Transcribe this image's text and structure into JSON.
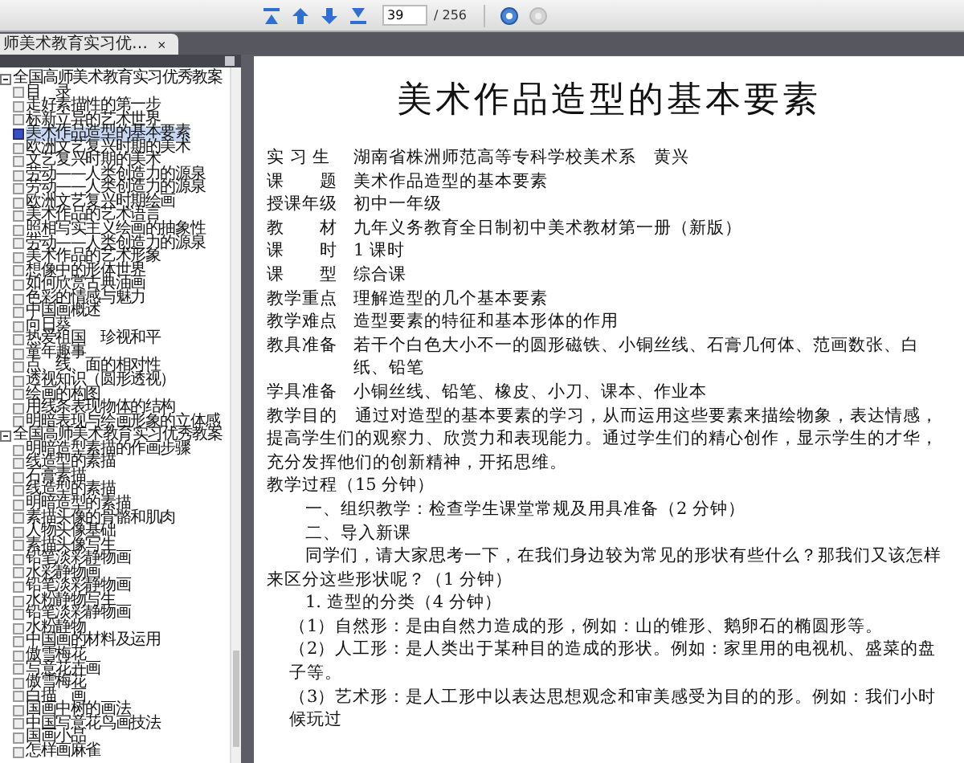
{
  "toolbar": {
    "page_input": {
      "value": "39"
    },
    "page_total": "/ 256"
  },
  "tab": {
    "label": "师美术教育实习优…",
    "close": "×",
    "selected": true
  },
  "sidebar": {
    "tree": [
      {
        "label": "全国高师美术教育实习优秀教案",
        "expanded": true,
        "selected": false,
        "children": [
          {
            "label": "目　录",
            "selected": false
          },
          {
            "label": "走好素描性的第一步",
            "selected": false
          },
          {
            "label": "标新立异的艺术世界",
            "selected": false
          },
          {
            "label": "美术作品造型的基本要素",
            "selected": true
          },
          {
            "label": "欧洲文艺复兴时期的美术",
            "selected": false
          },
          {
            "label": "文艺复兴时期的美术",
            "selected": false
          },
          {
            "label": "劳动——人类创造力的源泉",
            "selected": false
          },
          {
            "label": "劳动——人类创造力的源泉",
            "selected": false
          },
          {
            "label": "欧洲文艺复兴时期绘画",
            "selected": false
          },
          {
            "label": "美术作品的艺术语言",
            "selected": false
          },
          {
            "label": "照相写实主义绘画的抽象性",
            "selected": false
          },
          {
            "label": "劳动——人类创造力的源泉",
            "selected": false
          },
          {
            "label": "美术作品的艺术形象",
            "selected": false
          },
          {
            "label": "想像中的形体世界",
            "selected": false
          },
          {
            "label": "如何欣赏古典油画",
            "selected": false
          },
          {
            "label": "色彩的情感与魅力",
            "selected": false
          },
          {
            "label": "中国画概述",
            "selected": false
          },
          {
            "label": "向日葵",
            "selected": false
          },
          {
            "label": "热爱祖国　珍视和平",
            "selected": false
          },
          {
            "label": "童年趣事",
            "selected": false
          },
          {
            "label": "点、线、面的相对性",
            "selected": false
          },
          {
            "label": "透视知识（圆形透视）",
            "selected": false
          },
          {
            "label": "绘画的构图",
            "selected": false
          },
          {
            "label": "用线条表现物体的结构",
            "selected": false
          },
          {
            "label": "明暗表现与绘画形象的立体感",
            "selected": false
          }
        ]
      },
      {
        "label": "全国高师美术教育实习优秀教案",
        "expanded": true,
        "selected": false,
        "children": [
          {
            "label": "明暗造型素描的作画步骤",
            "selected": false
          },
          {
            "label": "线造型的素描",
            "selected": false
          },
          {
            "label": "石膏素描",
            "selected": false
          },
          {
            "label": "线造型的素描",
            "selected": false
          },
          {
            "label": "明暗造型的素描",
            "selected": false
          },
          {
            "label": "素描头像的骨骼和肌肉",
            "selected": false
          },
          {
            "label": "人物头像基础",
            "selected": false
          },
          {
            "label": "素描头像写生",
            "selected": false
          },
          {
            "label": "铅笔淡彩静物画",
            "selected": false
          },
          {
            "label": "水彩静物画",
            "selected": false
          },
          {
            "label": "铅笔淡彩静物画",
            "selected": false
          },
          {
            "label": "水粉静物写生",
            "selected": false
          },
          {
            "label": "铅笔淡彩静物画",
            "selected": false
          },
          {
            "label": "水粉静物",
            "selected": false
          },
          {
            "label": "中国画的材料及运用",
            "selected": false
          },
          {
            "label": "傲雪梅花",
            "selected": false
          },
          {
            "label": "写意花卉画",
            "selected": false
          },
          {
            "label": "傲雪梅花",
            "selected": false
          },
          {
            "label": "白描　画",
            "selected": false
          },
          {
            "label": "国画中树的画法",
            "selected": false
          },
          {
            "label": "中国写意花鸟画技法",
            "selected": false
          },
          {
            "label": "国画小品",
            "selected": false
          },
          {
            "label": "怎样画麻雀",
            "selected": false
          }
        ]
      }
    ]
  },
  "document": {
    "title": "美术作品造型的基本要素",
    "blocks": [
      {
        "kind": "field",
        "label": "实 习 生",
        "value": "湖南省株洲师范高等专科学校美术系　黄兴"
      },
      {
        "kind": "field",
        "label": "课　　题",
        "value": "美术作品造型的基本要素"
      },
      {
        "kind": "field",
        "label": "授课年级",
        "value": "初中一年级"
      },
      {
        "kind": "field",
        "label": "教　　材",
        "value": "九年义务教育全日制初中美术教材第一册（新版）"
      },
      {
        "kind": "field",
        "label": "课　　时",
        "value": "1 课时"
      },
      {
        "kind": "field",
        "label": "课　　型",
        "value": "综合课"
      },
      {
        "kind": "field",
        "label": "教学重点",
        "value": "理解造型的几个基本要素"
      },
      {
        "kind": "field",
        "label": "教学难点",
        "value": "造型要素的特征和基本形体的作用"
      },
      {
        "kind": "field",
        "label": "教具准备",
        "value": "若干个白色大小不一的圆形磁铁、小铜丝线、石膏几何体、范画数张、白纸、铅笔"
      },
      {
        "kind": "field",
        "label": "学具准备",
        "value": "小铜丝线、铅笔、橡皮、小刀、课本、作业本"
      },
      {
        "kind": "plain",
        "text": "教学目的　通过对造型的基本要素的学习，从而运用这些要素来描绘物象，表达情感，提高学生们的观察力、欣赏力和表现能力。通过学生们的精心创作，显示学生的才华，充分发挥他们的创新精神，开拓思维。"
      },
      {
        "kind": "plain",
        "text": "教学过程（15 分钟）"
      },
      {
        "kind": "indent",
        "text": "一、组织教学：检查学生课堂常规及用具准备（2 分钟）"
      },
      {
        "kind": "indent",
        "text": "二、导入新课"
      },
      {
        "kind": "para",
        "text": "同学们，请大家思考一下，在我们身边较为常见的形状有些什么？那我们又该怎样来区分这些形状呢？（1 分钟）"
      },
      {
        "kind": "indent",
        "text": "1. 造型的分类（4 分钟）"
      },
      {
        "kind": "item",
        "text": "（1）自然形：是由自然力造成的形，例如：山的锥形、鹅卵石的椭圆形等。"
      },
      {
        "kind": "item",
        "text": "（2）人工形：是人类出于某种目的造成的形状。例如：家里用的电视机、盛菜的盘子等。"
      },
      {
        "kind": "item",
        "text": "（3）艺术形：是人工形中以表达思想观念和审美感受为目的的形。例如：我们小时候玩过"
      }
    ]
  }
}
